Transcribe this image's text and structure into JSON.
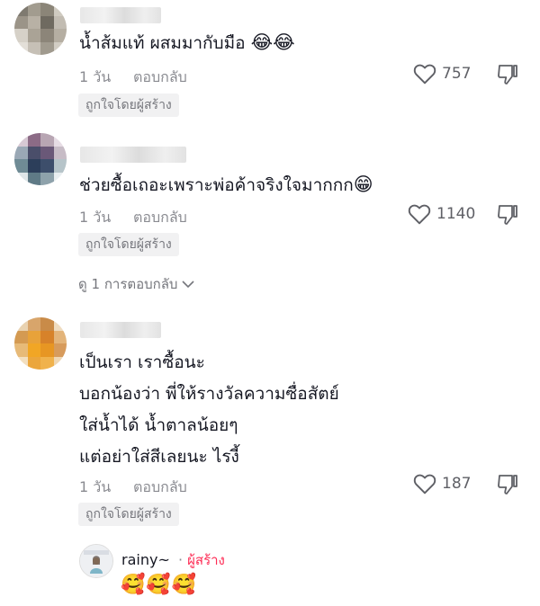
{
  "comments": [
    {
      "lines": [
        "น้ำส้มแท้ ผสมมากับมือ"
      ],
      "emoji": "😂😂",
      "time": "1 วัน",
      "reply_label": "ตอบกลับ",
      "likes": "757",
      "badge": "ถูกใจโดยผู้สร้าง"
    },
    {
      "lines": [
        "ช่วยซื้อเถอะเพราะพ่อค้าจริงใจมากกก"
      ],
      "emoji": "😁",
      "time": "1 วัน",
      "reply_label": "ตอบกลับ",
      "likes": "1140",
      "badge": "ถูกใจโดยผู้สร้าง",
      "view_replies": "ดู 1 การตอบกลับ"
    },
    {
      "lines": [
        "เป็นเรา เราซื้อนะ",
        "บอกน้องว่า พี่ให้รางวัลความซื่อสัตย์",
        "ใส่น้ำได้ น้ำตาลน้อยๆ",
        "แต่อย่าใส่สีเลยนะ ไรงี้"
      ],
      "time": "1 วัน",
      "reply_label": "ตอบกลับ",
      "likes": "187",
      "badge": "ถูกใจโดยผู้สร้าง"
    }
  ],
  "creator_reply": {
    "username": "rainy~",
    "separator": "·",
    "creator_label": "ผู้สร้าง",
    "emoji": "🥰🥰🥰"
  },
  "colors": {
    "text": "#161823",
    "muted": "#8a8b91",
    "creator": "#fe2c55",
    "badge_bg": "#f1f1f2"
  }
}
